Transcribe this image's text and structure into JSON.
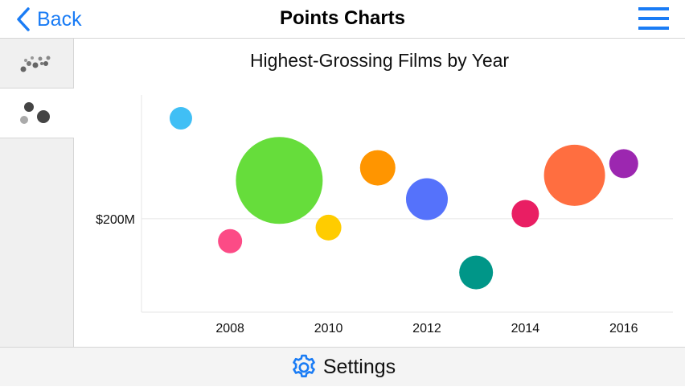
{
  "navbar": {
    "back_label": "Back",
    "title": "Points Charts",
    "menu_icon": "hamburger-menu-icon"
  },
  "sidebar": {
    "tabs": [
      {
        "icon": "scatter-points-icon",
        "active": false
      },
      {
        "icon": "bubble-points-icon",
        "active": true
      }
    ]
  },
  "chart_data": {
    "type": "scatter",
    "title": "Highest-Grossing Films by Year",
    "xlabel": "",
    "ylabel": "",
    "x_ticks": [
      "2008",
      "2010",
      "2012",
      "2014",
      "2016"
    ],
    "y_ticks": [
      {
        "value": 200,
        "label": "$200M"
      }
    ],
    "xlim": [
      2006.2,
      2017.0
    ],
    "ylim": [
      0,
      465
    ],
    "grid": "horizontal",
    "legend": "none",
    "points": [
      {
        "x": 2007,
        "y": 415,
        "size": 14,
        "color": "#40bff5"
      },
      {
        "x": 2008,
        "y": 152,
        "size": 15,
        "color": "#fc4b86"
      },
      {
        "x": 2009,
        "y": 282,
        "size": 54,
        "color": "#66dd3b"
      },
      {
        "x": 2010,
        "y": 181,
        "size": 16,
        "color": "#ffcc00"
      },
      {
        "x": 2011,
        "y": 309,
        "size": 22,
        "color": "#ff9500"
      },
      {
        "x": 2012,
        "y": 242,
        "size": 26,
        "color": "#5572fb"
      },
      {
        "x": 2013,
        "y": 85,
        "size": 21,
        "color": "#009688"
      },
      {
        "x": 2014,
        "y": 211,
        "size": 17,
        "color": "#e91e63"
      },
      {
        "x": 2015,
        "y": 293,
        "size": 38,
        "color": "#ff6e40"
      },
      {
        "x": 2016,
        "y": 318,
        "size": 18,
        "color": "#9c27b0"
      }
    ]
  },
  "bottombar": {
    "settings_label": "Settings",
    "settings_icon": "gear-icon"
  },
  "colors": {
    "accent": "#1a7cf5",
    "sidebar_bg": "#f0f0f0",
    "divider": "#d6d6d6"
  }
}
